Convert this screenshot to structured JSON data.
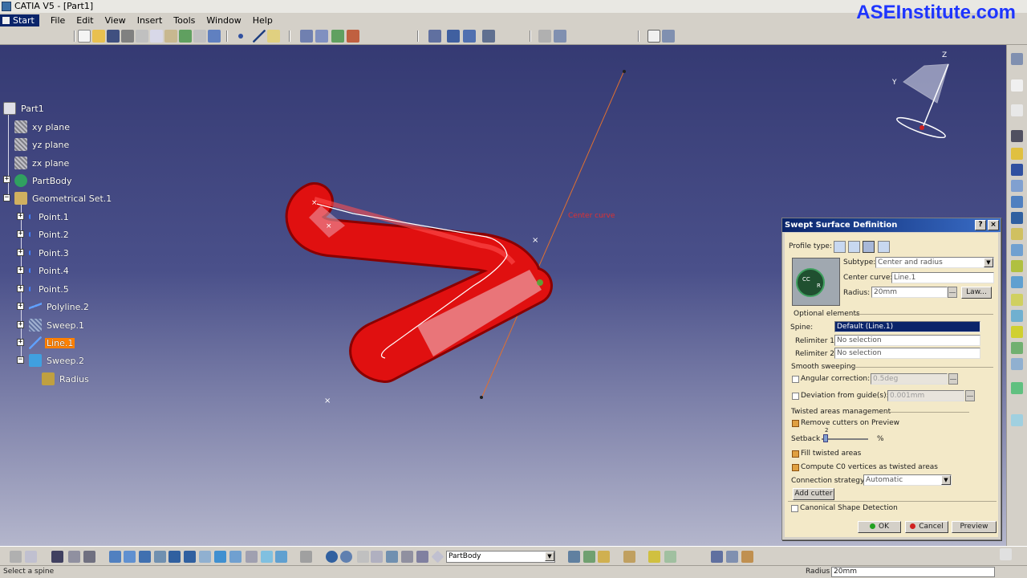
{
  "window": {
    "title": "CATIA V5 - [Part1]",
    "brand": "ASEInstitute.com"
  },
  "menu": [
    "Start",
    "File",
    "Edit",
    "View",
    "Insert",
    "Tools",
    "Window",
    "Help"
  ],
  "tree": {
    "root": "Part1",
    "items": [
      "xy plane",
      "yz plane",
      "zx plane",
      "PartBody",
      "Geometrical Set.1",
      "Point.1",
      "Point.2",
      "Point.3",
      "Point.4",
      "Point.5",
      "Polyline.2",
      "Sweep.1",
      "Line.1",
      "Sweep.2",
      "Radius"
    ],
    "selected": "Line.1"
  },
  "viewport": {
    "annotation": "Center curve",
    "compass_axes": [
      "Z",
      "Y"
    ]
  },
  "dialog": {
    "title": "Swept Surface Definition",
    "help": "?",
    "close": "×",
    "profile_type_label": "Profile type:",
    "subtype_label": "Subtype:",
    "subtype_value": "Center and radius",
    "center_curve_label": "Center curve:",
    "center_curve_value": "Line.1",
    "radius_label": "Radius:",
    "radius_value": "20mm",
    "law_button": "Law...",
    "optional_elements": "Optional elements",
    "spine_label": "Spine:",
    "spine_value": "Default (Line.1)",
    "relimiter1_label": "Relimiter 1:",
    "relimiter1_value": "No selection",
    "relimiter2_label": "Relimiter 2:",
    "relimiter2_value": "No selection",
    "smooth_sweeping": "Smooth sweeping",
    "angular_correction": "Angular correction:",
    "angular_value": "0.5deg",
    "deviation_label": "Deviation from guide(s):",
    "deviation_value": "0.001mm",
    "twisted_areas": "Twisted areas management",
    "remove_cutters": "Remove cutters on Preview",
    "setback_label": "Setback",
    "setback_value": "2",
    "setback_unit": "%",
    "fill_twisted": "Fill twisted areas",
    "compute_c0": "Compute C0 vertices as twisted areas",
    "connection_label": "Connection strategy:",
    "connection_value": "Automatic",
    "add_cutter": "Add cutter",
    "canonical": "Canonical Shape Detection",
    "ok": "OK",
    "cancel": "Cancel",
    "preview": "Preview",
    "diagram_labels": [
      "CC",
      "R"
    ]
  },
  "bottom": {
    "body_combo": "PartBody"
  },
  "status": {
    "message": "Select a spine",
    "param_label": "Radius",
    "param_value": "20mm"
  }
}
